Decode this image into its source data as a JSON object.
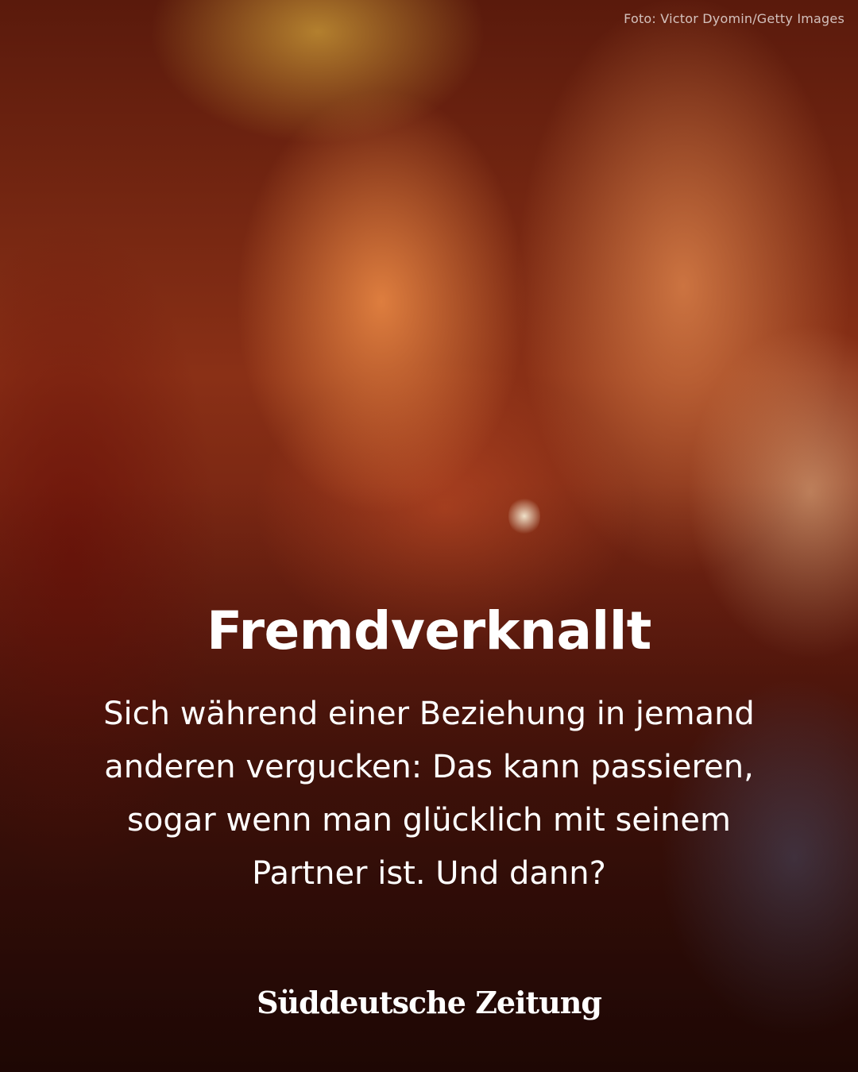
{
  "photo": {
    "credit": "Foto: Victor Dyomin/Getty Images"
  },
  "article": {
    "title": "Fremdverknallt",
    "teaser": "Sich während einer Beziehung in jemand anderen vergucken: Das kann passieren, sogar wenn man glücklich mit seinem Partner ist. Und dann?"
  },
  "brand": {
    "logo_text": "Süddeutsche Zeitung"
  }
}
